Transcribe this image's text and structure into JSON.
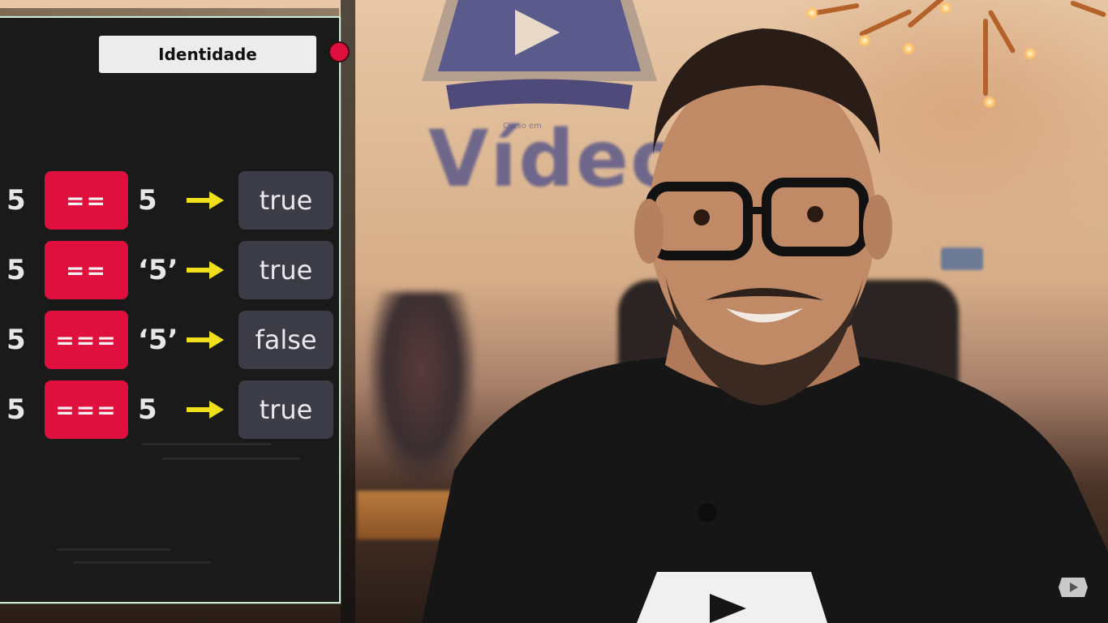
{
  "slide": {
    "title": "Identidade",
    "rows": [
      {
        "left": "5",
        "operator": "==",
        "right": "5",
        "result": "true"
      },
      {
        "left": "5",
        "operator": "==",
        "right": "‘5’",
        "result": "true"
      },
      {
        "left": "5",
        "operator": "===",
        "right": "‘5’",
        "result": "false"
      },
      {
        "left": "5",
        "operator": "===",
        "right": "5",
        "result": "true"
      }
    ]
  },
  "background": {
    "logo_word": "Vídeo",
    "logo_small": "Curso em"
  },
  "icons": {
    "arrow": "right-arrow-icon",
    "record": "record-dot-icon",
    "channel": "play-badge-icon"
  },
  "colors": {
    "operator_bg": "#e0103e",
    "result_bg": "#3c3c47",
    "arrow": "#f0e01c",
    "panel_bg": "#1a1a1a"
  }
}
